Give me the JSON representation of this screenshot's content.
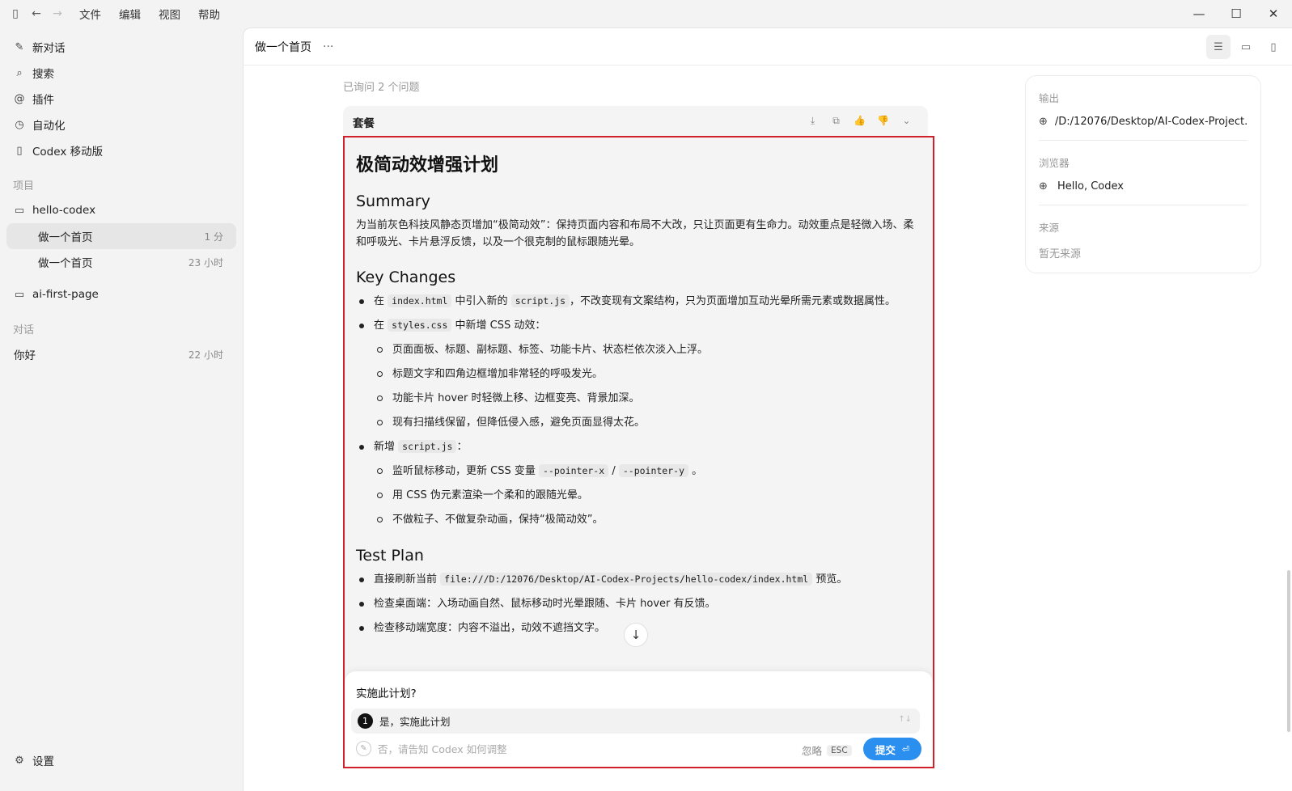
{
  "titlebar": {
    "menu": [
      "文件",
      "编辑",
      "视图",
      "帮助"
    ]
  },
  "sidebar": {
    "nav": [
      {
        "icon": "edit-icon",
        "label": "新对话"
      },
      {
        "icon": "search-icon",
        "label": "搜索"
      },
      {
        "icon": "at-icon",
        "label": "插件"
      },
      {
        "icon": "clock-icon",
        "label": "自动化"
      },
      {
        "icon": "phone-icon",
        "label": "Codex 移动版"
      }
    ],
    "projects_label": "项目",
    "project1": "hello-codex",
    "project1_convs": [
      {
        "label": "做一个首页",
        "time": "1 分"
      },
      {
        "label": "做一个首页",
        "time": "23 小时"
      }
    ],
    "project2": "ai-first-page",
    "convs_label": "对话",
    "convs": [
      {
        "label": "你好",
        "time": "22 小时"
      }
    ],
    "settings": "设置"
  },
  "main": {
    "title": "做一个首页",
    "more": "···",
    "asked": "已询问 2 个问题",
    "card_label": "套餐"
  },
  "plan": {
    "title": "极简动效增强计划",
    "summary_heading": "Summary",
    "summary_text": "为当前灰色科技风静态页增加“极简动效”：保持页面内容和布局不大改，只让页面更有生命力。动效重点是轻微入场、柔和呼吸光、卡片悬浮反馈，以及一个很克制的鼠标跟随光晕。",
    "key_heading": "Key Changes",
    "k1_pre": "在",
    "k1_code1": "index.html",
    "k1_mid": "中引入新的",
    "k1_code2": "script.js",
    "k1_post": "，不改变现有文案结构，只为页面增加互动光晕所需元素或数据属性。",
    "k2_pre": "在",
    "k2_code": "styles.css",
    "k2_post": "中新增 CSS 动效：",
    "k2_subs": [
      "页面面板、标题、副标题、标签、功能卡片、状态栏依次淡入上浮。",
      "标题文字和四角边框增加非常轻的呼吸发光。",
      "功能卡片 hover 时轻微上移、边框变亮、背景加深。",
      "现有扫描线保留，但降低侵入感，避免页面显得太花。"
    ],
    "k3_pre": "新增",
    "k3_code": "script.js",
    "k3_post": "：",
    "k3_s1_pre": "监听鼠标移动，更新 CSS 变量",
    "k3_s1_code1": "--pointer-x",
    "k3_s1_sep": "/",
    "k3_s1_code2": "--pointer-y",
    "k3_s1_post": "。",
    "k3_s2": "用 CSS 伪元素渲染一个柔和的跟随光晕。",
    "k3_s3": "不做粒子、不做复杂动画，保持“极简动效”。",
    "test_heading": "Test Plan",
    "t1_pre": "直接刷新当前",
    "t1_code": "file:///D:/12076/Desktop/AI-Codex-Projects/hello-codex/index.html",
    "t1_post": "预览。",
    "t2": "检查桌面端：入场动画自然、鼠标移动时光晕跟随、卡片 hover 有反馈。",
    "t3": "检查移动端宽度：内容不溢出，动效不遮挡文字。"
  },
  "ask": {
    "question": "实施此计划?",
    "option_number": "1",
    "option_text": "是，实施此计划",
    "option_arrows": "↑↓",
    "adjust_placeholder": "否，请告知 Codex 如何调整",
    "ignore_label": "忽略",
    "ignore_key": "ESC",
    "submit_label": "提交"
  },
  "info": {
    "output_label": "输出",
    "output_value": "/D:/12076/Desktop/AI-Codex-Project...",
    "browser_label": "浏览器",
    "browser_value": "Hello, Codex",
    "source_label": "来源",
    "source_value": "暂无来源"
  }
}
